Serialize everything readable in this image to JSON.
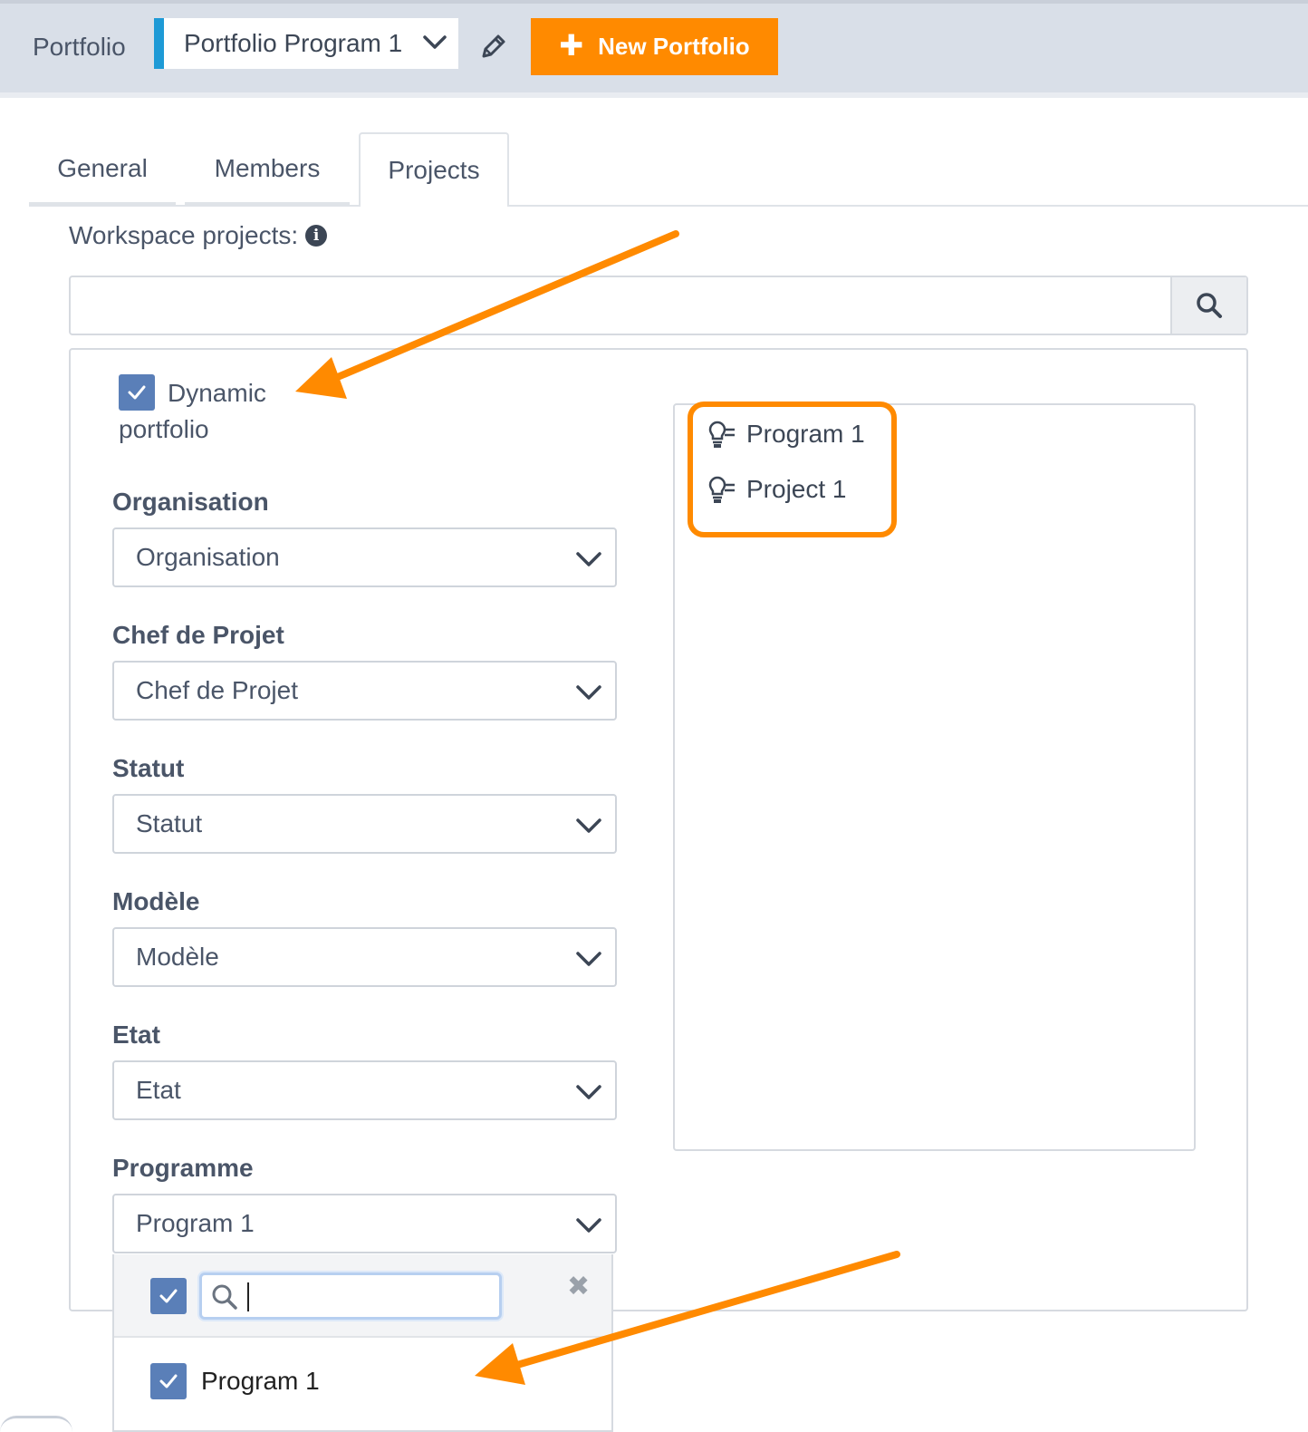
{
  "header": {
    "portfolio_label": "Portfolio",
    "selected_portfolio": "Portfolio Program 1",
    "new_portfolio_label": "New Portfolio",
    "accent_color": "#1e9ad6",
    "button_color": "#ff8a00"
  },
  "tabs": [
    {
      "label": "General",
      "active": false
    },
    {
      "label": "Members",
      "active": false
    },
    {
      "label": "Projects",
      "active": true
    }
  ],
  "workspace": {
    "label": "Workspace projects:",
    "search_value": "",
    "info_icon": "info-circle-icon",
    "search_icon": "search-icon"
  },
  "filters": {
    "dynamic_checkbox_label": "Dynamic portfolio",
    "dynamic_checked": true,
    "fields": [
      {
        "label": "Organisation",
        "value": "Organisation"
      },
      {
        "label": "Chef de Projet",
        "value": "Chef de Projet"
      },
      {
        "label": "Statut",
        "value": "Statut"
      },
      {
        "label": "Modèle",
        "value": "Modèle"
      },
      {
        "label": "Etat",
        "value": "Etat"
      },
      {
        "label": "Programme",
        "value": "Program 1"
      }
    ],
    "dropdown": {
      "search_value": "",
      "select_all_checked": true,
      "options": [
        {
          "label": "Program 1",
          "checked": true
        }
      ]
    }
  },
  "projects_list": [
    {
      "name": "Program 1",
      "icon": "program-icon"
    },
    {
      "name": "Project 1",
      "icon": "project-icon"
    }
  ],
  "annotation_color": "#ff8a00"
}
